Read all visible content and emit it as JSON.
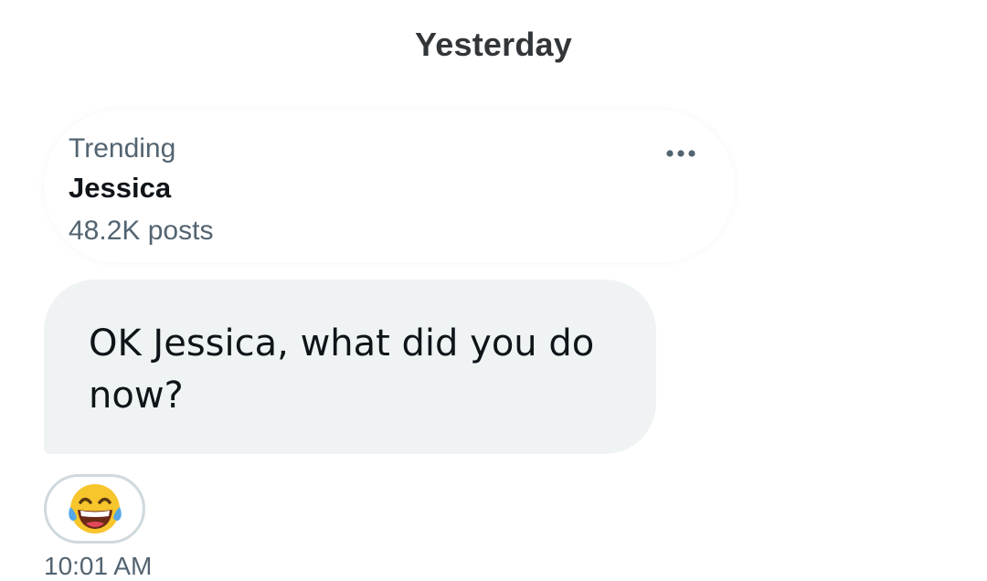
{
  "conversation": {
    "date_divider": "Yesterday"
  },
  "trend_card": {
    "label": "Trending",
    "name": "Jessica",
    "post_count": "48.2K posts",
    "more_icon": "more-horizontal-icon"
  },
  "message": {
    "text": "OK Jessica, what did you do now?",
    "bubble_color": "#eff3f4",
    "reaction_emoji": "face-with-tears-of-joy-icon",
    "timestamp": "10:01 AM"
  },
  "colors": {
    "primary_text": "#0f1419",
    "secondary_text": "#536471",
    "reaction_border": "#cfd9de"
  }
}
